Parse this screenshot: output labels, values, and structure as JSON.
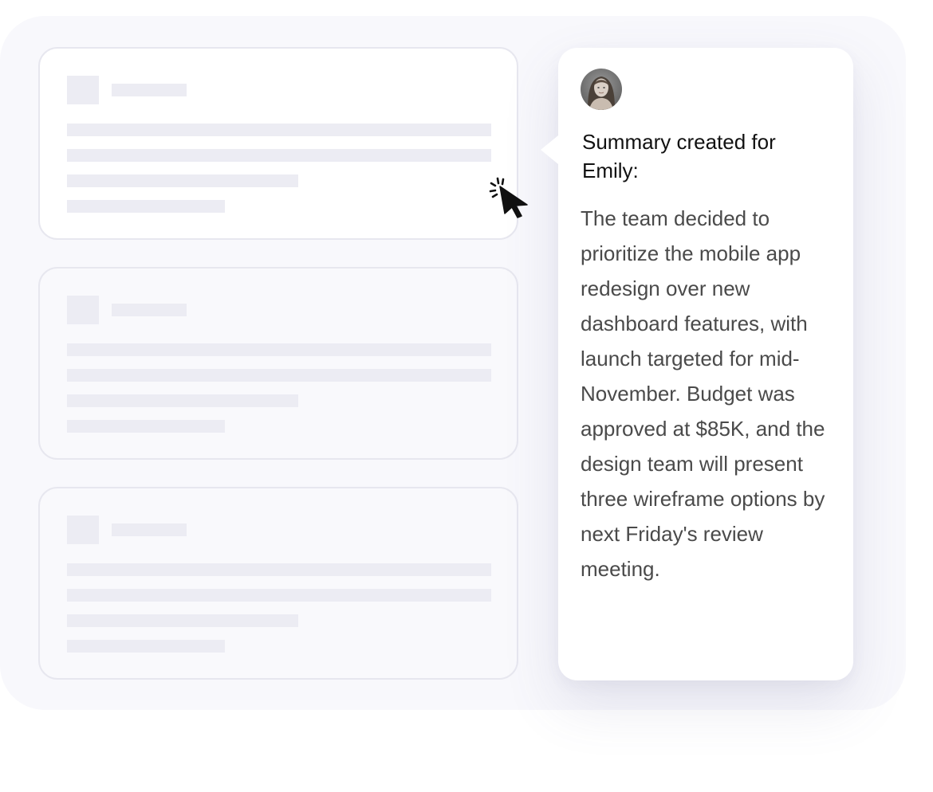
{
  "summary_popover": {
    "avatar_icon": "user-avatar-icon",
    "heading": "Summary created for Emily:",
    "body": "The team decided to prioritize the mobile app redesign over new dashboard features, with launch targeted for mid-November. Budget was approved at $85K, and the design team will present three wireframe options by next Friday's review meeting."
  },
  "cards": [
    {
      "state": "active"
    },
    {
      "state": "inactive"
    },
    {
      "state": "inactive"
    }
  ],
  "cursor_icon": "click-pointer-icon",
  "colors": {
    "backdrop": "#f8f8fc",
    "card_border": "#e7e7ef",
    "skeleton": "#ececf3",
    "popover_bg": "#ffffff",
    "heading_text": "#111111",
    "body_text": "#4a4a4a"
  }
}
